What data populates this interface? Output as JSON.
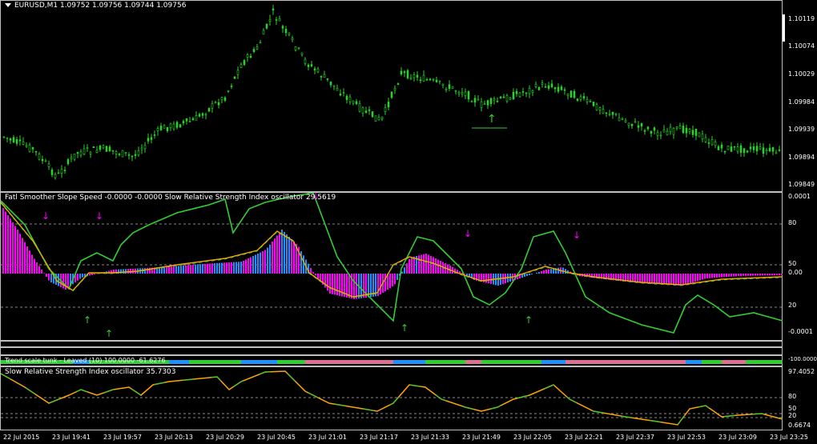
{
  "symbol_title": "EURUSD,M1  1.09752 1.09756 1.09744 1.09756",
  "ind1_title": "Fatl Smoother Slope Speed -0.0000 -0.0000  Slow Relative Strength Index oscillator 29.5619",
  "ind2_title": "Trend scale tunk - Leaved (10) 100.0000 -61.6276",
  "ind3_title": "Slow Relative Strength Index oscillator 35.7303",
  "price_ticks": [
    "1.10119",
    "1.10074",
    "1.10029",
    "1.09984",
    "1.09939",
    "1.09894",
    "1.09849"
  ],
  "ind1_ticks": [
    "0.0001",
    "80",
    "50",
    "0.00",
    "20",
    "-0.0001"
  ],
  "ind3_ticks": [
    "97.4052",
    "80",
    "50",
    "20",
    "0.6674"
  ],
  "ind2_right": "-100.0000",
  "time_labels": [
    "22 Jul 2015",
    "23 Jul 19:41",
    "23 Jul 19:57",
    "23 Jul 20:13",
    "23 Jul 20:29",
    "23 Jul 20:45",
    "23 Jul 21:01",
    "23 Jul 21:17",
    "23 Jul 21:33",
    "23 Jul 21:49",
    "23 Jul 22:05",
    "23 Jul 22:21",
    "23 Jul 22:37",
    "23 Jul 22:53",
    "23 Jul 23:09",
    "23 Jul 23:25"
  ],
  "colors": {
    "candle": "#32cd32",
    "magenta": "#ff00ff",
    "cyan": "#1e90ff",
    "orange": "#ffa500",
    "green": "#32cd32",
    "grid": "#c0c0c0"
  }
}
